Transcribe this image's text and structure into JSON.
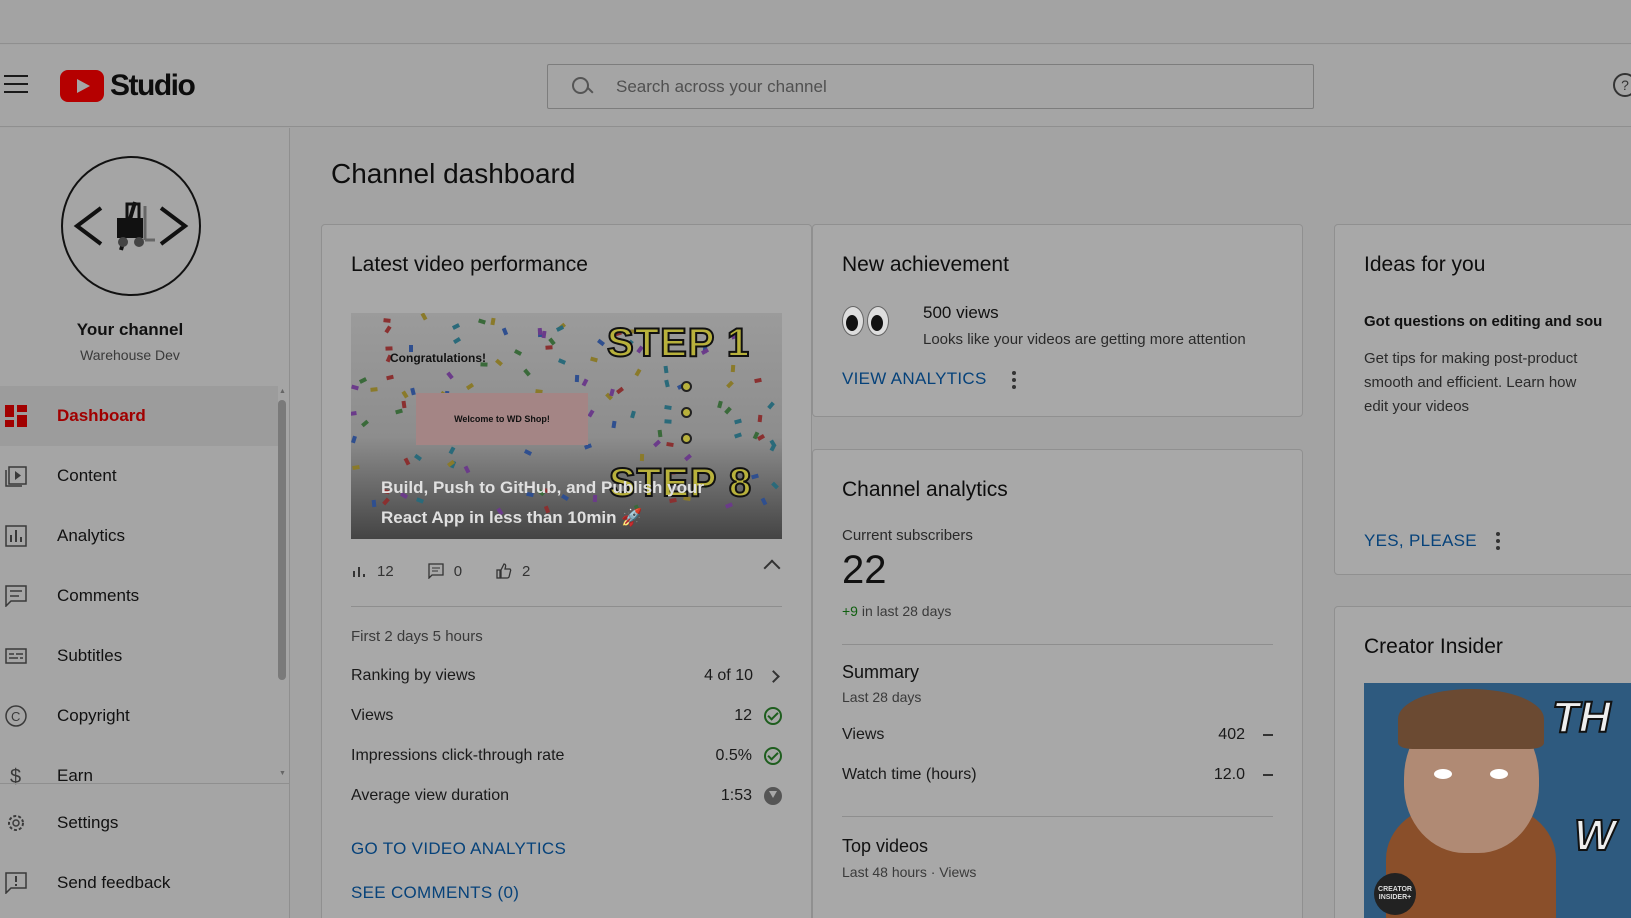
{
  "header": {
    "logo_text": "Studio",
    "search_placeholder": "Search across your channel"
  },
  "sidebar": {
    "channel_name": "Your channel",
    "channel_handle": "Warehouse Dev",
    "items": [
      {
        "label": "Dashboard",
        "icon": "dashboard-icon",
        "active": true
      },
      {
        "label": "Content",
        "icon": "content-icon"
      },
      {
        "label": "Analytics",
        "icon": "analytics-icon"
      },
      {
        "label": "Comments",
        "icon": "comments-icon"
      },
      {
        "label": "Subtitles",
        "icon": "subtitles-icon"
      },
      {
        "label": "Copyright",
        "icon": "copyright-icon"
      },
      {
        "label": "Earn",
        "icon": "earn-icon"
      }
    ],
    "bottom_items": [
      {
        "label": "Settings",
        "icon": "gear-icon"
      },
      {
        "label": "Send feedback",
        "icon": "feedback-icon"
      }
    ]
  },
  "main": {
    "page_title": "Channel dashboard",
    "latest_video": {
      "title": "Latest video performance",
      "video_title": "Build, Push to GitHub, and Publish your React App in less than 10min 🚀",
      "thumb_text": {
        "congrats": "Congratulations!",
        "welcome": "Welcome to WD Shop!",
        "step1": "STEP 1",
        "step8": "STEP 8"
      },
      "stats": {
        "views": "12",
        "comments": "0",
        "likes": "2"
      },
      "period": "First 2 days 5 hours",
      "metrics": [
        {
          "label": "Ranking by views",
          "value": "4 of 10",
          "indicator": "chevron-right"
        },
        {
          "label": "Views",
          "value": "12",
          "indicator": "check"
        },
        {
          "label": "Impressions click-through rate",
          "value": "0.5%",
          "indicator": "check"
        },
        {
          "label": "Average view duration",
          "value": "1:53",
          "indicator": "down"
        }
      ],
      "link_analytics": "GO TO VIDEO ANALYTICS",
      "link_comments": "SEE COMMENTS (0)"
    },
    "achievement": {
      "title": "New achievement",
      "headline": "500 views",
      "sub": "Looks like your videos are getting more attention",
      "link": "VIEW ANALYTICS"
    },
    "channel_analytics": {
      "title": "Channel analytics",
      "subs_label": "Current subscribers",
      "subs_value": "22",
      "delta_value": "+9",
      "delta_text": "in last 28 days",
      "summary_title": "Summary",
      "summary_period": "Last 28 days",
      "summary_rows": [
        {
          "label": "Views",
          "value": "402"
        },
        {
          "label": "Watch time (hours)",
          "value": "12.0"
        }
      ],
      "top_videos_title": "Top videos",
      "top_videos_period": "Last 48 hours · Views"
    },
    "ideas": {
      "title": "Ideas for you",
      "question": "Got questions on editing and sou",
      "body": "Get tips for making post-product\nsmooth and efficient. Learn how\nedit your videos",
      "link": "YES, PLEASE"
    },
    "creator_insider": {
      "title": "Creator Insider",
      "thumb_text_top": "TH",
      "thumb_text_bottom": "W",
      "badge": "CREATOR INSIDER+"
    }
  },
  "colors": {
    "brand_red": "#b50000",
    "link_blue": "#06427a",
    "active_red": "#a10000",
    "positive_green": "#0f5f0f"
  }
}
